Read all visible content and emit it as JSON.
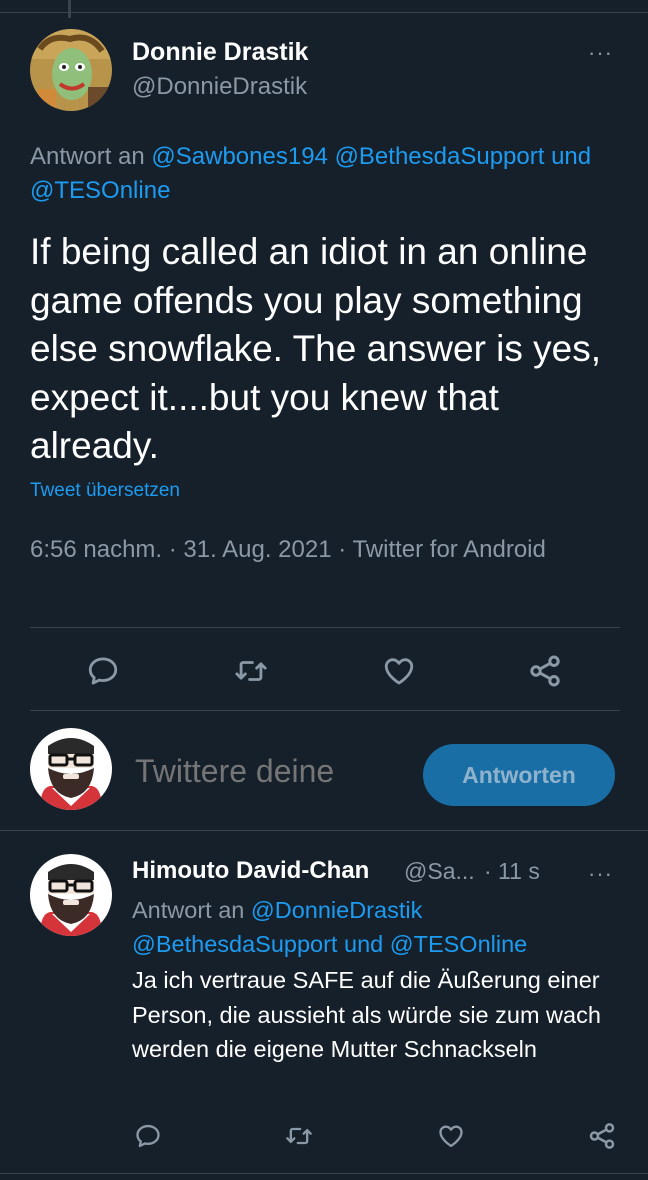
{
  "tweet": {
    "author_name": "Donnie Drastik",
    "author_handle": "@DonnieDrastik",
    "reply_prefix": "Antwort an",
    "reply_mentions": [
      "@Sawbones194",
      "@BethesdaSupport"
    ],
    "reply_joiner": "und",
    "reply_last_mention": "@TESOnline",
    "text": "If being called an idiot in an online game offends you play something else snowflake. The answer is yes, expect it....but you knew that already.",
    "translate_label": "Tweet übersetzen",
    "timestamp": "6:56 nachm. · 31. Aug. 2021 · Twitter for Android",
    "more_label": "···"
  },
  "actions": {
    "reply_icon": "reply-icon",
    "retweet_icon": "retweet-icon",
    "like_icon": "heart-icon",
    "share_icon": "share-icon"
  },
  "compose": {
    "placeholder": "Twittere deine",
    "button_label": "Antworten"
  },
  "reply_tweet": {
    "author_name": "Himouto David-Chan",
    "author_handle": "@Sa...",
    "time": "· 11 s",
    "reply_prefix": "Antwort an",
    "reply_first_mention": "@DonnieDrastik",
    "reply_second_mention": "@BethesdaSupport",
    "reply_joiner": "und",
    "reply_last_mention": "@TESOnline",
    "text": "Ja ich vertraue SAFE auf die Äußerung einer Person, die aussieht als würde sie zum wach werden die eigene Mutter Schnackseln",
    "more_label": "···"
  },
  "colors": {
    "background": "#15202b",
    "link": "#1d9bf0",
    "muted": "#8b98a5",
    "divider": "#38444d"
  }
}
